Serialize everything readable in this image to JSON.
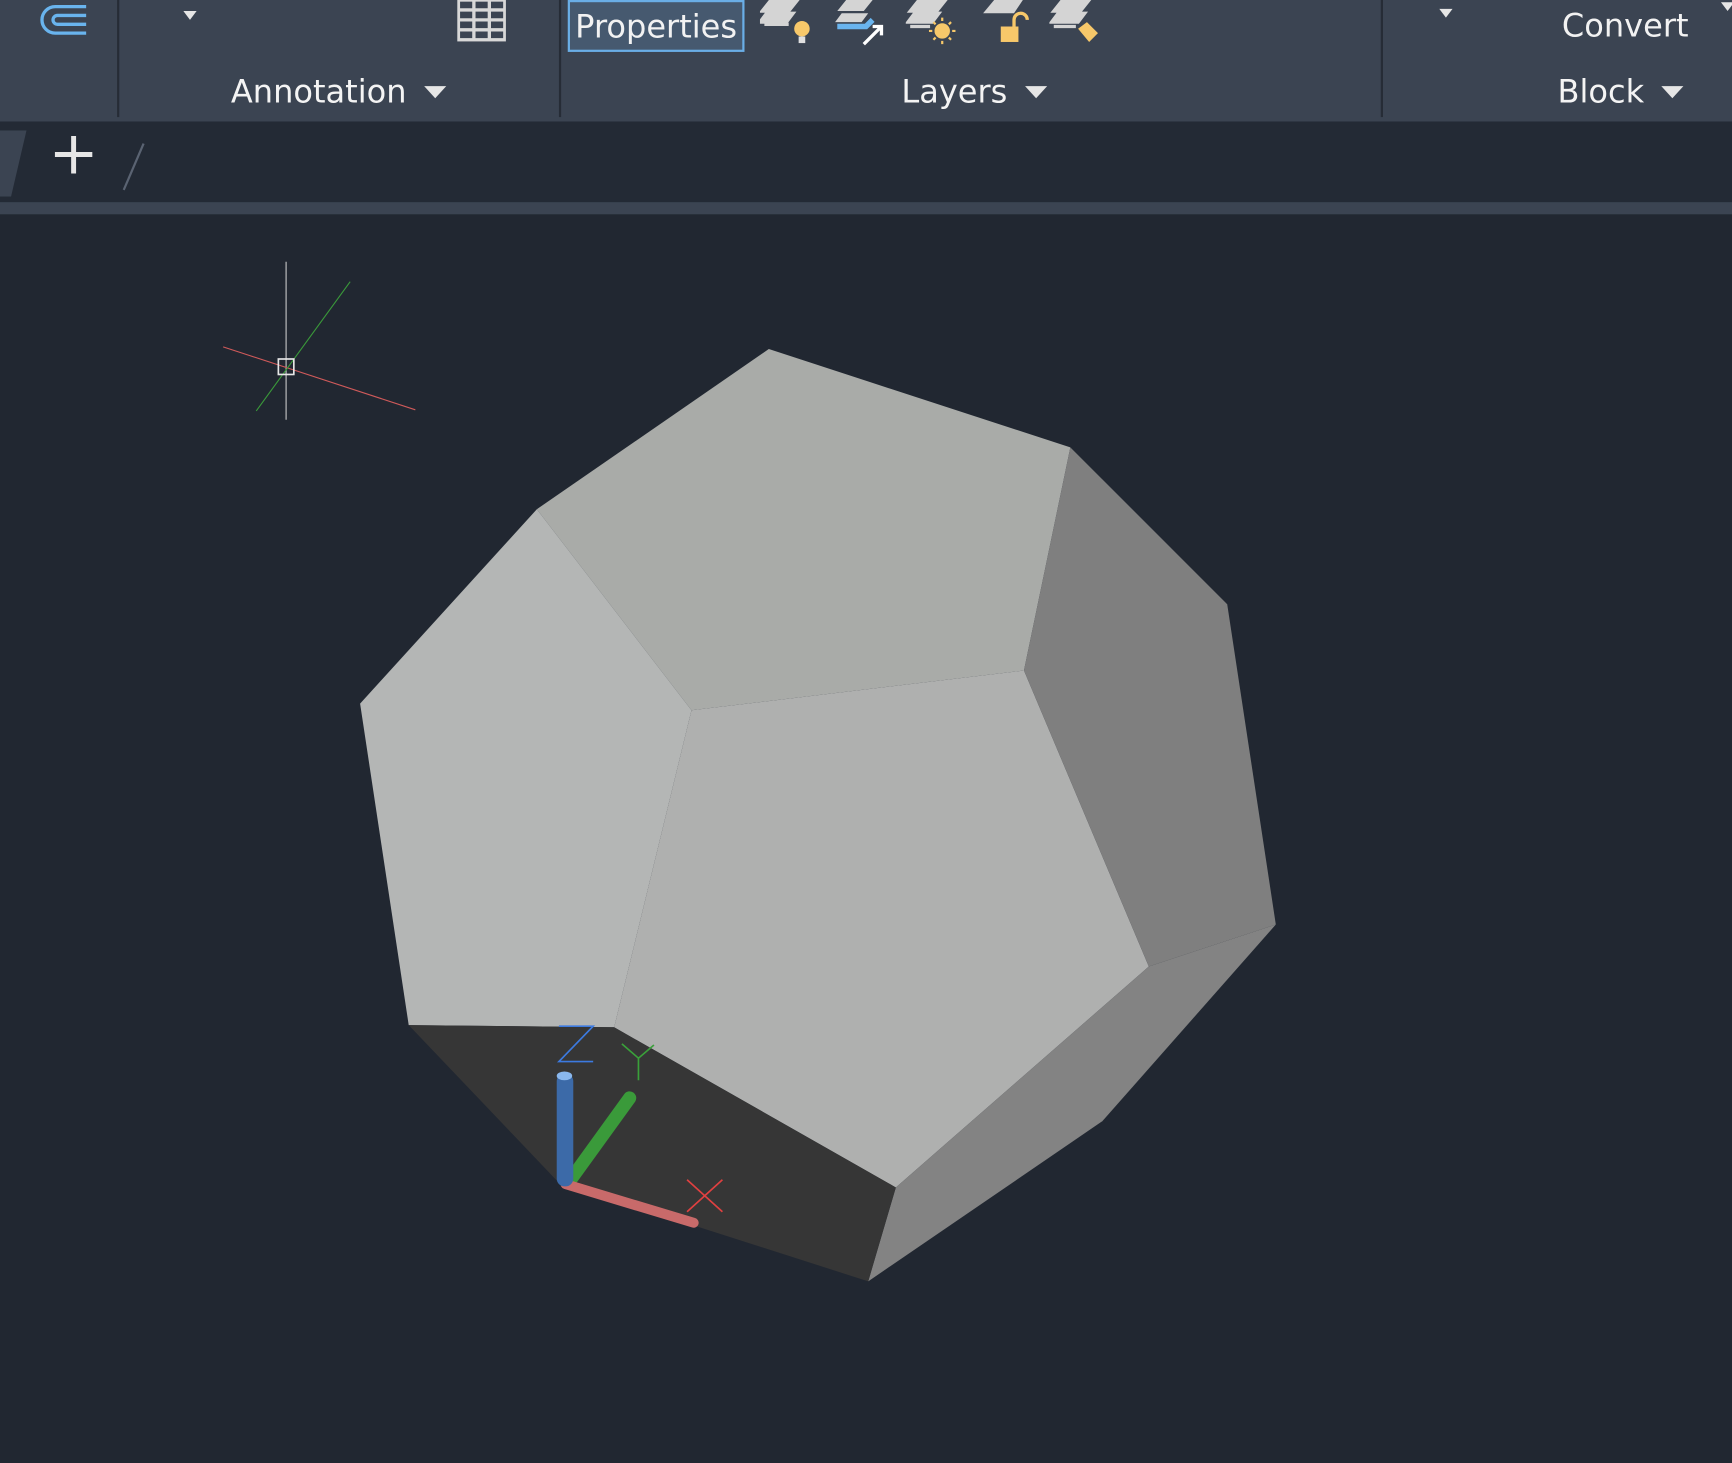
{
  "ribbon": {
    "panels": [
      {
        "label": "Annotation"
      },
      {
        "label": "Layers"
      },
      {
        "label": "Block"
      }
    ],
    "properties_button": "Properties",
    "convert_button": "Convert",
    "layer_tools": [
      "layer-off-icon",
      "layer-match-icon",
      "layer-isolate-icon",
      "layer-unlock-icon",
      "layer-walk-icon"
    ]
  },
  "tabs": {
    "new_tab_symbol": "+"
  },
  "viewport": {
    "ucs": {
      "x_label": "X",
      "y_label": "Y",
      "z_label": "Z"
    },
    "colors": {
      "background": "#212731",
      "x_axis": "#d06060",
      "y_axis": "#3a9a3a",
      "z_axis": "#3c6aa8"
    }
  }
}
